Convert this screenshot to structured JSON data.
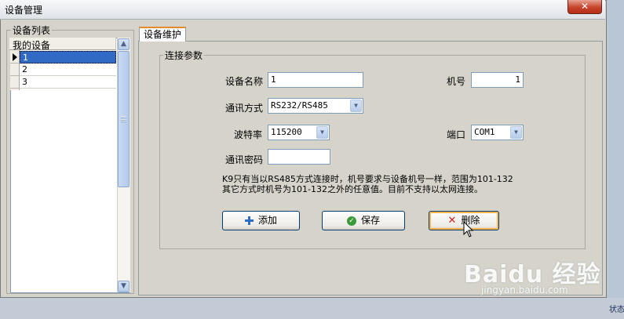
{
  "window": {
    "title": "设备管理",
    "close_glyph": "✕"
  },
  "device_list": {
    "legend": "设备列表",
    "column_header": "我的设备",
    "rows": [
      "1",
      "2",
      "3"
    ],
    "selected_row": "1"
  },
  "tab": {
    "label": "设备维护"
  },
  "connection": {
    "legend": "连接参数",
    "device_name_label": "设备名称",
    "device_name_value": "1",
    "machine_no_label": "机号",
    "machine_no_value": "1",
    "comm_mode_label": "通讯方式",
    "comm_mode_value": "RS232/RS485",
    "baud_label": "波特率",
    "baud_value": "115200",
    "port_label": "端口",
    "port_value": "COM1",
    "password_label": "通讯密码",
    "password_value": "",
    "note_line1": "K9只有当以RS485方式连接时，机号要求与设备机号一样，范围为101-132",
    "note_line2": "其它方式时机号为101-132之外的任意值。目前不支持以太网连接。"
  },
  "buttons": {
    "add": "添加",
    "save": "保存",
    "delete": "删除"
  },
  "background": {
    "status_fragment": "状态"
  },
  "watermark": {
    "logo": "Baidu 经验",
    "url": "jingyan.baidu.com"
  },
  "icons": {
    "add": "plus-icon",
    "save": "check-circle-icon",
    "delete": "x-icon",
    "close": "close-icon"
  },
  "colors": {
    "selection": "#316ac5",
    "close_button": "#c7432b",
    "tab_accent": "#e68b2c"
  }
}
